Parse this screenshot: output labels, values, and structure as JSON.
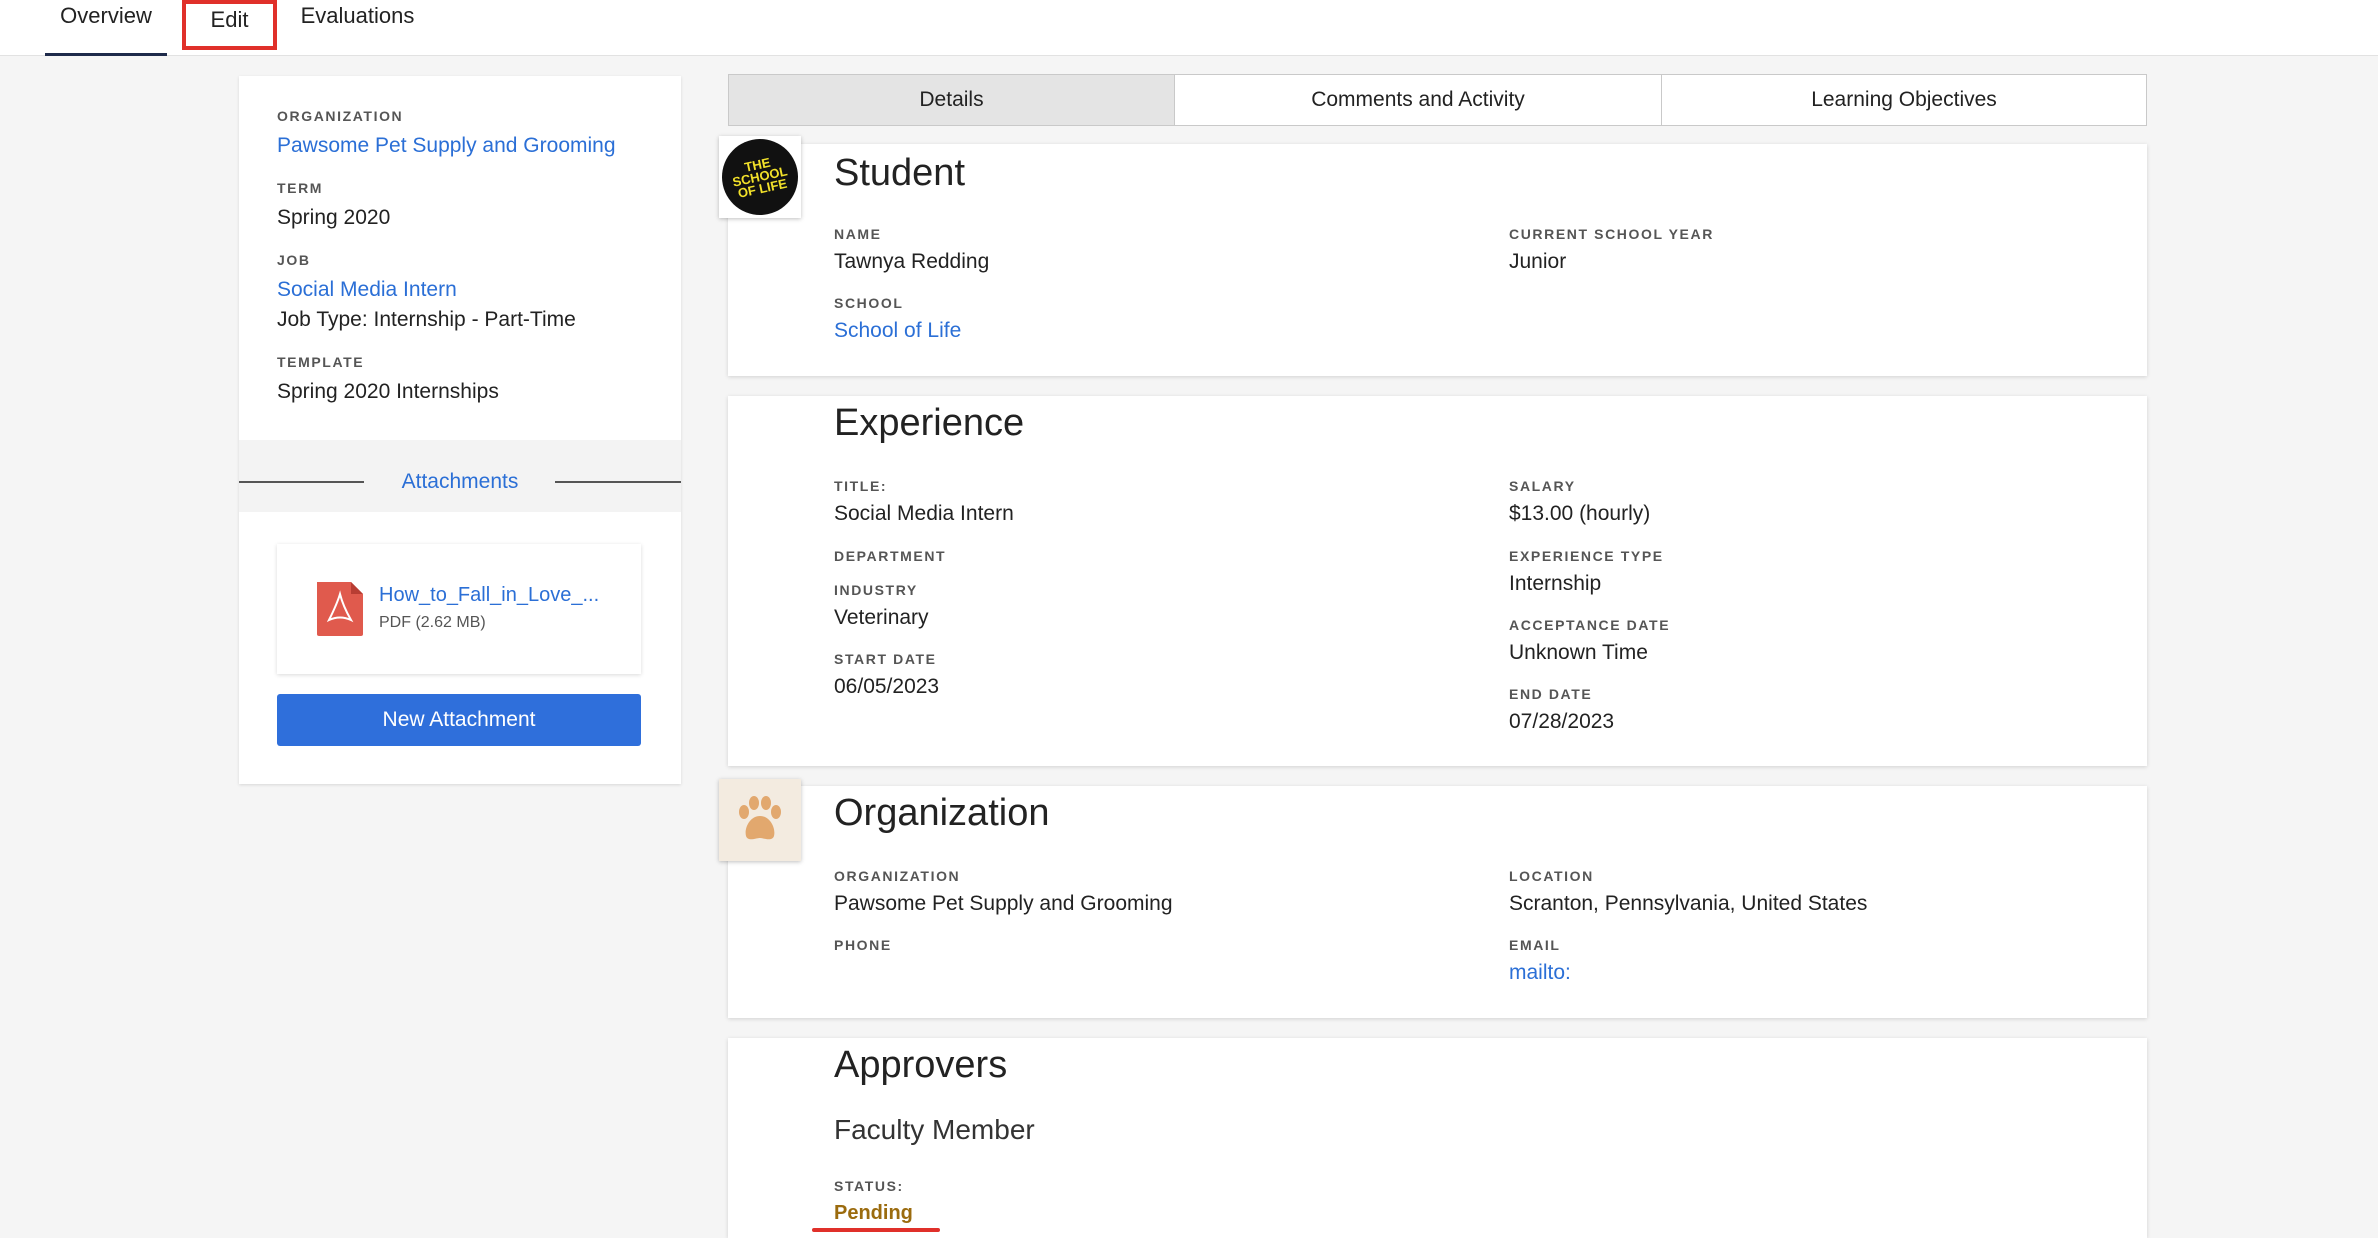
{
  "nav": {
    "tabs": [
      "Overview",
      "Edit",
      "Evaluations"
    ]
  },
  "left": {
    "org_label": "ORGANIZATION",
    "org_value": "Pawsome Pet Supply and Grooming",
    "term_label": "TERM",
    "term_value": "Spring 2020",
    "job_label": "JOB",
    "job_value": "Social Media Intern",
    "job_type": "Job Type: Internship - Part-Time",
    "template_label": "TEMPLATE",
    "template_value": "Spring 2020 Internships",
    "attachments_title": "Attachments",
    "file_name": "How_to_Fall_in_Love_...",
    "file_meta": "PDF (2.62 MB)",
    "new_attachment": "New Attachment"
  },
  "rtabs": [
    "Details",
    "Comments and Activity",
    "Learning Objectives"
  ],
  "student": {
    "title": "Student",
    "logo_text": "THE SCHOOL OF LIFE",
    "name_label": "NAME",
    "name_value": "Tawnya Redding",
    "year_label": "CURRENT SCHOOL YEAR",
    "year_value": "Junior",
    "school_label": "SCHOOL",
    "school_value": "School of Life"
  },
  "experience": {
    "title": "Experience",
    "title_label": "TITLE:",
    "title_value": "Social Media Intern",
    "salary_label": "SALARY",
    "salary_value": "$13.00 (hourly)",
    "department_label": "DEPARTMENT",
    "exp_type_label": "EXPERIENCE TYPE",
    "exp_type_value": "Internship",
    "industry_label": "INDUSTRY",
    "industry_value": "Veterinary",
    "acceptance_label": "ACCEPTANCE DATE",
    "acceptance_value": "Unknown Time",
    "start_label": "START DATE",
    "start_value": "06/05/2023",
    "end_label": "END DATE",
    "end_value": "07/28/2023"
  },
  "organization": {
    "title": "Organization",
    "org_label": "ORGANIZATION",
    "org_value": "Pawsome Pet Supply and Grooming",
    "location_label": "LOCATION",
    "location_value": "Scranton, Pennsylvania, United States",
    "phone_label": "PHONE",
    "email_label": "EMAIL",
    "email_value": "mailto:"
  },
  "approvers": {
    "title": "Approvers",
    "faculty": "Faculty Member",
    "status_label": "STATUS:",
    "status_value": "Pending"
  },
  "colors": {
    "link": "#2b6fd6",
    "highlight": "#e0302a",
    "pending": "#9b6b0e",
    "button": "#2f6fdb"
  }
}
